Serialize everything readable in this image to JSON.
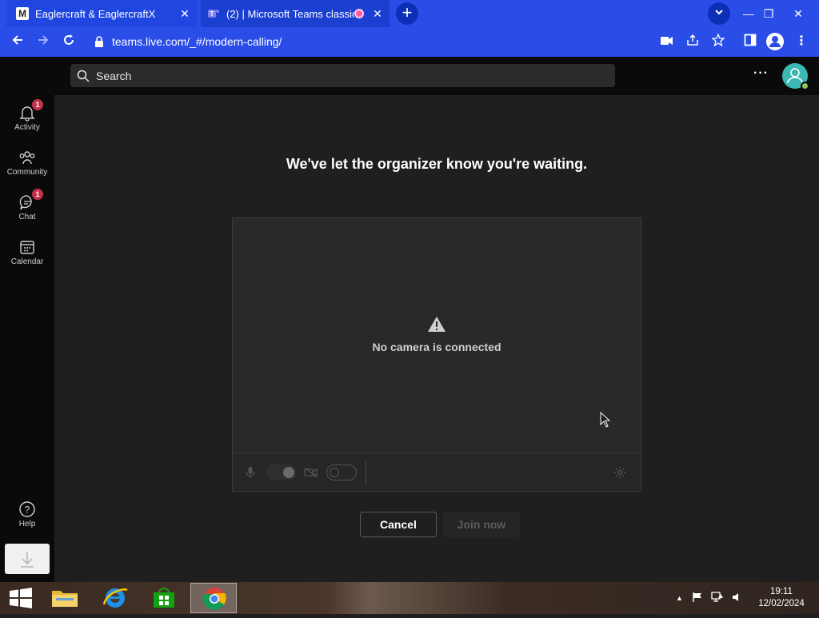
{
  "browser": {
    "tabs": [
      {
        "title": "Eaglercraft & EaglercraftX",
        "favicon": "M",
        "active": true
      },
      {
        "title": "(2) | Microsoft Teams classic",
        "recording": true,
        "active": false
      }
    ],
    "url": "teams.live.com/_#/modern-calling/",
    "accent_color": "#2a4de8"
  },
  "teams": {
    "search_placeholder": "Search",
    "more_label": "···",
    "rail": [
      {
        "label": "Activity",
        "icon": "bell-icon",
        "badge": "1"
      },
      {
        "label": "Community",
        "icon": "community-icon",
        "badge": ""
      },
      {
        "label": "Chat",
        "icon": "chat-icon",
        "badge": "1"
      },
      {
        "label": "Calendar",
        "icon": "calendar-icon",
        "badge": ""
      }
    ],
    "help_label": "Help",
    "lobby": {
      "message": "We've let the organizer know you're waiting.",
      "no_camera": "No camera is connected",
      "cancel_label": "Cancel",
      "join_label": "Join now"
    }
  },
  "taskbar": {
    "time": "19:11",
    "date": "12/02/2024"
  }
}
